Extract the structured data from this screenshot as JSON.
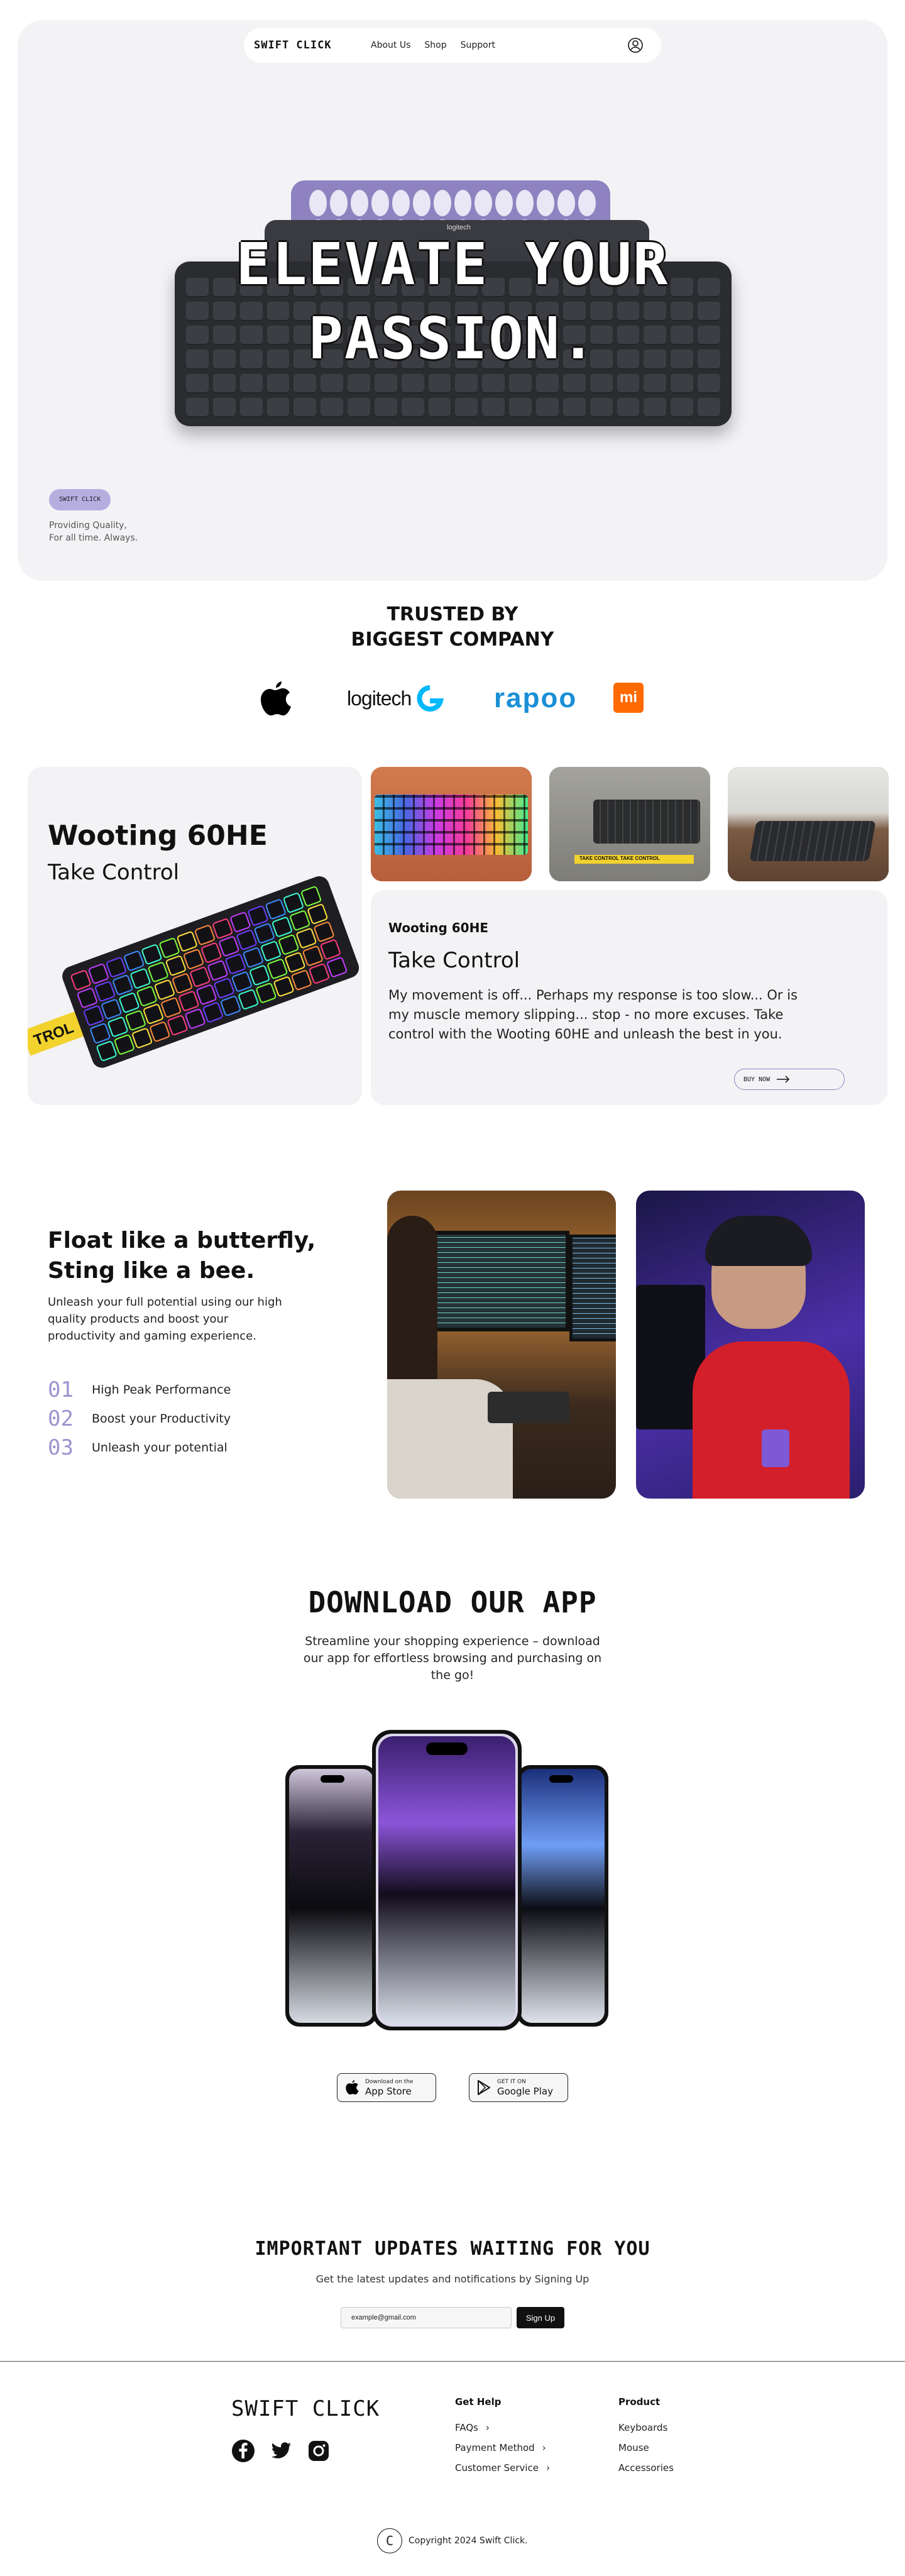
{
  "nav": {
    "brand": "SWIFT CLICK",
    "links": [
      "About Us",
      "Shop",
      "Support"
    ],
    "user_icon": "user-circle-icon"
  },
  "hero": {
    "title": "ELEVATE YOUR\nPASSION.",
    "badge": "SWIFT CLICK",
    "tagline": "Providing Quality,\nFor all time. Always.",
    "keyboard_brand": "logitech"
  },
  "trusted": {
    "title": "TRUSTED BY\nBIGGEST COMPANY",
    "logos": [
      "apple-logo",
      "logitech",
      "rapoo",
      "mi"
    ],
    "logitech_text": "logitech",
    "rapoo_text": "rapoo",
    "mi_text": "mi"
  },
  "product": {
    "name": "Wooting 60HE",
    "subtitle": "Take Control",
    "desc_kicker": "Wooting 60HE",
    "desc_title": "Take Control",
    "desc_body": "My movement is off... Perhaps my response is too slow... Or is my muscle memory slipping... stop - no more excuses. Take control with the Wooting 60HE and unleash the best in you.",
    "cta": "BUY NOW",
    "cable_text": "TROL",
    "thumb_cable_text": "TAKE CONTROL  TAKE CONTROL"
  },
  "butterfly": {
    "title": "Float like a butterfly,\nSting like a bee.",
    "body": "Unleash your full potential using our high quality products and boost your productivity and gaming experience.",
    "items": [
      {
        "num": "01",
        "label": "High Peak Performance"
      },
      {
        "num": "02",
        "label": "Boost your Productivity"
      },
      {
        "num": "03",
        "label": "Unleash your potential"
      }
    ]
  },
  "download": {
    "title": "DOWNLOAD OUR APP",
    "body": "Streamline your shopping experience – download our app for effortless browsing and purchasing on the go!",
    "app_store": {
      "small": "Download on the",
      "big": "App Store"
    },
    "google_play": {
      "small": "GET IT ON",
      "big": "Google Play"
    }
  },
  "updates": {
    "title": "IMPORTANT UPDATES WAITING FOR YOU",
    "body": "Get the latest updates and notifications by Signing Up",
    "email_value": "example@gmail.com",
    "button": "Sign Up"
  },
  "footer": {
    "brand": "SWIFT CLICK",
    "socials": [
      "facebook-icon",
      "twitter-icon",
      "instagram-icon"
    ],
    "help_title": "Get Help",
    "help_links": [
      "FAQs",
      "Payment Method",
      "Customer Service"
    ],
    "product_title": "Product",
    "product_links": [
      "Keyboards",
      "Mouse",
      "Accessories"
    ],
    "copyright": "Copyright 2024 Swift Click.",
    "copyright_icon_letter": "C"
  },
  "colors": {
    "accent_lavender": "#b7aee0",
    "accent_purple": "#8e83c0",
    "panel_bg": "#f3f3f6",
    "text_dark": "#111111"
  }
}
